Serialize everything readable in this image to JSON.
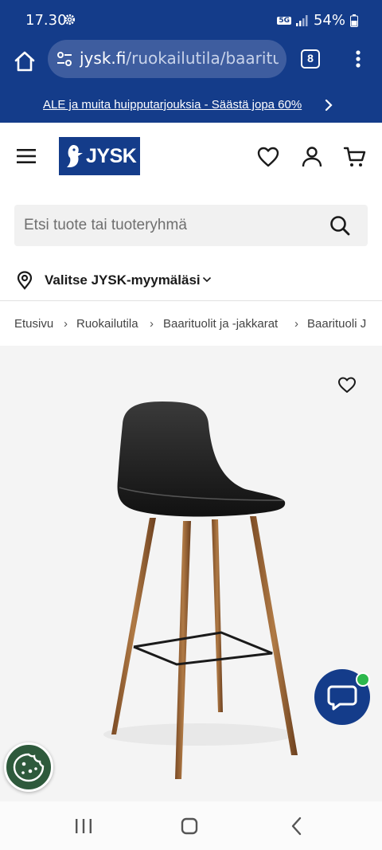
{
  "status_bar": {
    "time": "17.30",
    "network": "5G",
    "battery": "54%"
  },
  "browser": {
    "url_host": "jysk.fi",
    "url_path": "/ruokailutila/baarituo",
    "tab_count": "8"
  },
  "promo": {
    "text": "ALE ja muita huipputarjouksia - Säästä jopa 60%"
  },
  "header": {
    "logo_text": "JYSK"
  },
  "search": {
    "placeholder": "Etsi tuote tai tuoteryhmä"
  },
  "store": {
    "label": "Valitse JYSK-myymäläsi"
  },
  "breadcrumb": {
    "items": [
      "Etusivu",
      "Ruokailutila",
      "Baarituolit ja -jakkarat",
      "Baarituoli J"
    ],
    "separator": "›"
  },
  "colors": {
    "brand_blue": "#143c8a",
    "chat_status_green": "#2db84c",
    "cookie_green": "#2e5a3c"
  },
  "icons": {
    "home": "home-icon",
    "tune": "tune-icon",
    "menu": "hamburger-icon",
    "wishlist": "heart-icon",
    "account": "person-icon",
    "cart": "cart-icon",
    "search": "search-icon",
    "location": "location-pin-icon",
    "chat": "chat-icon",
    "cookie": "cookie-icon"
  }
}
